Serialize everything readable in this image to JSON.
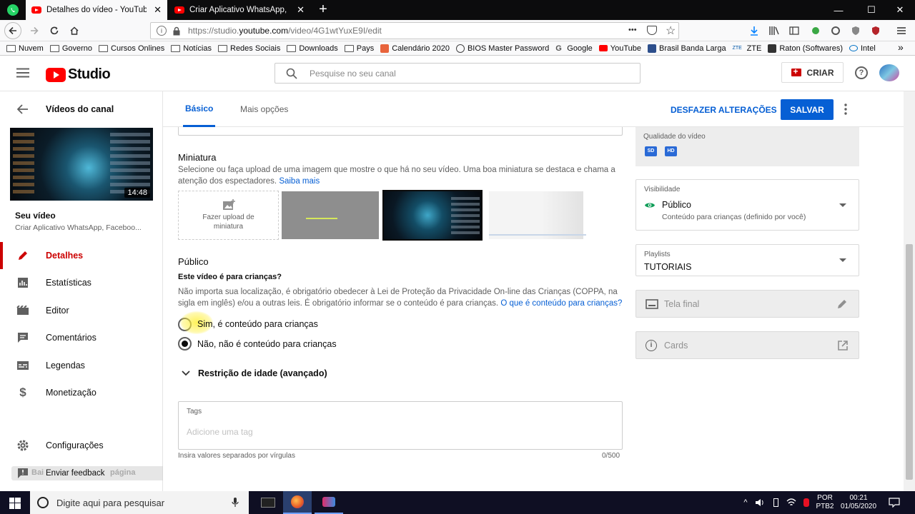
{
  "browser": {
    "tabs": [
      {
        "label": "Detalhes do vídeo - YouTube St",
        "active": true
      },
      {
        "label": "Criar Aplicativo WhatsApp, Fac",
        "active": false
      }
    ],
    "new_tab_symbol": "+",
    "url_prefix": "https://studio.",
    "url_domain": "youtube.com",
    "url_path": "/video/4G1wtYuxE9I/edit",
    "url_more": "•••",
    "window_controls": {
      "minimize": "—",
      "maximize": "☐",
      "close": "✕"
    }
  },
  "bookmarks": [
    {
      "label": "Nuvem",
      "icon": "folder-icon"
    },
    {
      "label": "Governo",
      "icon": "folder-icon"
    },
    {
      "label": "Cursos Onlines",
      "icon": "folder-icon"
    },
    {
      "label": "Notícias",
      "icon": "folder-icon"
    },
    {
      "label": "Redes Sociais",
      "icon": "folder-icon"
    },
    {
      "label": "Downloads",
      "icon": "folder-icon"
    },
    {
      "label": "Pays",
      "icon": "folder-icon"
    },
    {
      "label": "Calendário 2020",
      "icon": "calendar-icon"
    },
    {
      "label": "BIOS Master Password",
      "icon": "globe-icon"
    },
    {
      "label": "Google",
      "icon": "google-icon"
    },
    {
      "label": "YouTube",
      "icon": "youtube-icon"
    },
    {
      "label": "Brasil Banda Larga",
      "icon": "bbl-icon"
    },
    {
      "label": "ZTE",
      "icon": "zte-icon"
    },
    {
      "label": "Raton (Softwares)",
      "icon": "raton-icon"
    },
    {
      "label": "Intel",
      "icon": "intel-icon"
    }
  ],
  "bookmarks_overflow": "»",
  "studio": {
    "logo_text": "Studio",
    "search_placeholder": "Pesquise no seu canal",
    "create_label": "CRIAR"
  },
  "sidebar": {
    "back_label": "Vídeos do canal",
    "thumb_duration": "14:48",
    "your_video_label": "Seu vídeo",
    "video_title": "Criar Aplicativo WhatsApp, Faceboo...",
    "items": [
      {
        "label": "Detalhes",
        "icon": "pencil-icon",
        "active": true
      },
      {
        "label": "Estatísticas",
        "icon": "analytics-icon",
        "active": false
      },
      {
        "label": "Editor",
        "icon": "film-icon",
        "active": false
      },
      {
        "label": "Comentários",
        "icon": "comment-icon",
        "active": false
      },
      {
        "label": "Legendas",
        "icon": "subtitles-icon",
        "active": false
      },
      {
        "label": "Monetização",
        "icon": "dollar-icon",
        "active": false
      }
    ],
    "settings_label": "Configurações",
    "feedback_label": "Enviar feedback",
    "overlay_text": "Bai",
    "overlay_text2": "página"
  },
  "editor": {
    "tabs": [
      {
        "label": "Básico",
        "active": true
      },
      {
        "label": "Mais opções",
        "active": false
      }
    ],
    "undo_label": "DESFAZER ALTERAÇÕES",
    "save_label": "SALVAR",
    "thumbnail": {
      "title": "Miniatura",
      "desc": "Selecione ou faça upload de uma imagem que mostre o que há no seu vídeo. Uma boa miniatura se destaca e chama a atenção dos espectadores.",
      "link": "Saiba mais",
      "upload_label": "Fazer upload de miniatura"
    },
    "audience": {
      "title": "Público",
      "question": "Este vídeo é para crianças?",
      "desc": "Não importa sua localização, é obrigatório obedecer à Lei de Proteção da Privacidade On-line das Crianças (COPPA, na sigla em inglês) e/ou a outras leis. É obrigatório informar se o conteúdo é para crianças.",
      "link": "O que é conteúdo para crianças?",
      "option_yes": "Sim, é conteúdo para crianças",
      "option_no": "Não, não é conteúdo para crianças",
      "selected": "no"
    },
    "age_restriction": "Restrição de idade (avançado)",
    "tags": {
      "label": "Tags",
      "placeholder": "Adicione uma tag",
      "hint": "Insira valores separados por vírgulas",
      "counter": "0/500"
    }
  },
  "right_panel": {
    "quality_label": "Qualidade do vídeo",
    "quality_badges": [
      "SD",
      "HD"
    ],
    "visibility": {
      "label": "Visibilidade",
      "value": "Público",
      "sub": "Conteúdo para crianças (definido por você)"
    },
    "playlists": {
      "label": "Playlists",
      "value": "TUTORIAIS"
    },
    "end_screen": "Tela final",
    "cards": "Cards"
  },
  "taskbar": {
    "search_placeholder": "Digite aqui para pesquisar",
    "lang": "POR",
    "layout": "PTB2",
    "time": "00:21",
    "date": "01/05/2020"
  },
  "colors": {
    "accent": "#065fd4",
    "brand_red": "#ff0000",
    "active_red": "#cc0000",
    "visibility_green": "#0f9d58"
  }
}
